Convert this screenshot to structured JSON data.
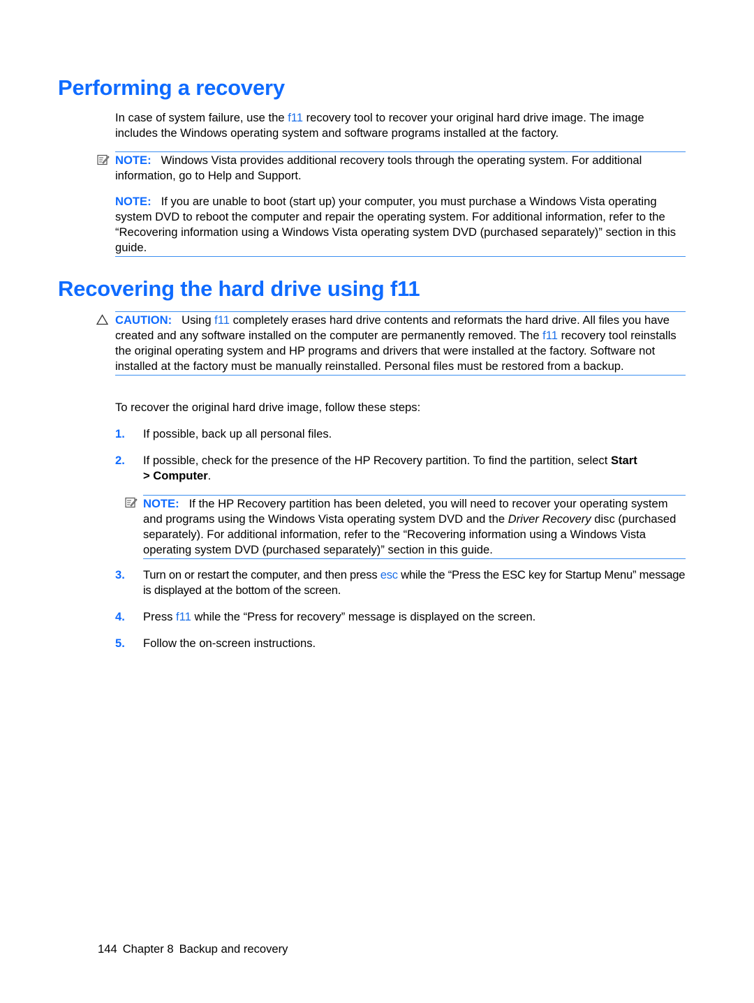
{
  "section1": {
    "title": "Performing a recovery",
    "intro": {
      "before": "In case of system failure, use the ",
      "key": "f11",
      "after": " recovery tool to recover your original hard drive image. The image includes the Windows operating system and software programs installed at the factory."
    },
    "note1": {
      "icon": "note-icon",
      "label": "NOTE:",
      "text": "Windows Vista provides additional recovery tools through the operating system. For additional information, go to Help and Support."
    },
    "note2": {
      "label": "NOTE:",
      "text": "If you are unable to boot (start up) your computer, you must purchase a Windows Vista operating system DVD to reboot the computer and repair the operating system. For additional information, refer to the “Recovering information using a Windows Vista operating system DVD (purchased separately)” section in this guide."
    }
  },
  "section2": {
    "title": "Recovering the hard drive using f11",
    "caution": {
      "icon": "caution-triangle-icon",
      "label": "CAUTION:",
      "t1": "Using ",
      "k1": "f11",
      "t2": " completely erases hard drive contents and reformats the hard drive. All files you have created and any software installed on the computer are permanently removed. The ",
      "k2": "f11",
      "t3": " recovery tool reinstalls the original operating system and HP programs and drivers that were installed at the factory. Software not installed at the factory must be manually reinstalled. Personal files must be restored from a backup."
    },
    "steps_intro": "To recover the original hard drive image, follow these steps:",
    "steps": [
      {
        "num": "1.",
        "text": "If possible, back up all personal files."
      },
      {
        "num": "2.",
        "text": "If possible, check for the presence of the HP Recovery partition. To find the partition, select ",
        "bold1": "Start",
        "text2": " ",
        "bold2": "> Computer",
        "text3": "."
      },
      {
        "num": "3.",
        "t1": "Turn on or restart the computer, and then press ",
        "key": "esc",
        "t2": " while the “Press the ESC key for Startup Menu” message is displayed at the bottom of the screen."
      },
      {
        "num": "4.",
        "t1": "Press ",
        "key": "f11",
        "t2": " while the “Press for recovery” message is displayed on the screen."
      },
      {
        "num": "5.",
        "text": "Follow the on-screen instructions."
      }
    ],
    "step2_note": {
      "icon": "note-icon",
      "label": "NOTE:",
      "t1": "If the HP Recovery partition has been deleted, you will need to recover your operating system and programs using the Windows Vista operating system DVD and the ",
      "italic": "Driver Recovery",
      "t2": " disc (purchased separately). For additional information, refer to the “Recovering information using a Windows Vista operating system DVD (purchased separately)” section in this guide."
    }
  },
  "footer": {
    "page_number": "144",
    "chapter": "Chapter 8",
    "chapter_title": "Backup and recovery"
  }
}
